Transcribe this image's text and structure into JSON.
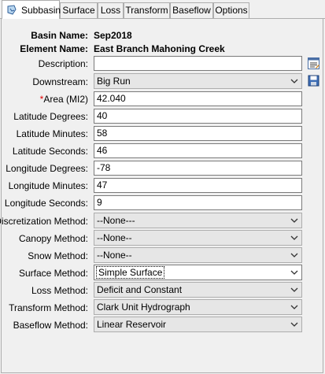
{
  "tabs": [
    {
      "label": "Subbasin",
      "active": true
    },
    {
      "label": "Surface"
    },
    {
      "label": "Loss"
    },
    {
      "label": "Transform"
    },
    {
      "label": "Baseflow"
    },
    {
      "label": "Options"
    }
  ],
  "header": {
    "basin_label": "Basin Name:",
    "basin_value": "Sep2018",
    "element_label": "Element Name:",
    "element_value": "East Branch Mahoning Creek"
  },
  "fields": {
    "description": {
      "label": "Description:",
      "value": ""
    },
    "downstream": {
      "label": "Downstream:",
      "value": "Big Run"
    },
    "area": {
      "required_mark": "*",
      "label": "Area (MI2)",
      "value": "42.040"
    },
    "lat_deg": {
      "label": "Latitude Degrees:",
      "value": "40"
    },
    "lat_min": {
      "label": "Latitude Minutes:",
      "value": "58"
    },
    "lat_sec": {
      "label": "Latitude Seconds:",
      "value": "46"
    },
    "lon_deg": {
      "label": "Longitude Degrees:",
      "value": "-78"
    },
    "lon_min": {
      "label": "Longitude Minutes:",
      "value": "47"
    },
    "lon_sec": {
      "label": "Longitude Seconds:",
      "value": "9"
    },
    "discretization": {
      "label": "Discretization Method:",
      "value": "--None---"
    },
    "canopy": {
      "label": "Canopy Method:",
      "value": "--None--"
    },
    "snow": {
      "label": "Snow Method:",
      "value": "--None--"
    },
    "surface": {
      "label": "Surface Method:",
      "value": "Simple Surface"
    },
    "loss": {
      "label": "Loss Method:",
      "value": "Deficit and Constant"
    },
    "transform": {
      "label": "Transform Method:",
      "value": "Clark Unit Hydrograph"
    },
    "baseflow": {
      "label": "Baseflow Method:",
      "value": "Linear Reservoir"
    }
  },
  "icons": {
    "tab_icon": "subbasin-icon",
    "edit_button": "edit-description-icon",
    "save_button": "save-icon",
    "dropdown": "chevron-down-icon"
  },
  "colors": {
    "required": "#e00000",
    "tab_border": "#adadad"
  }
}
